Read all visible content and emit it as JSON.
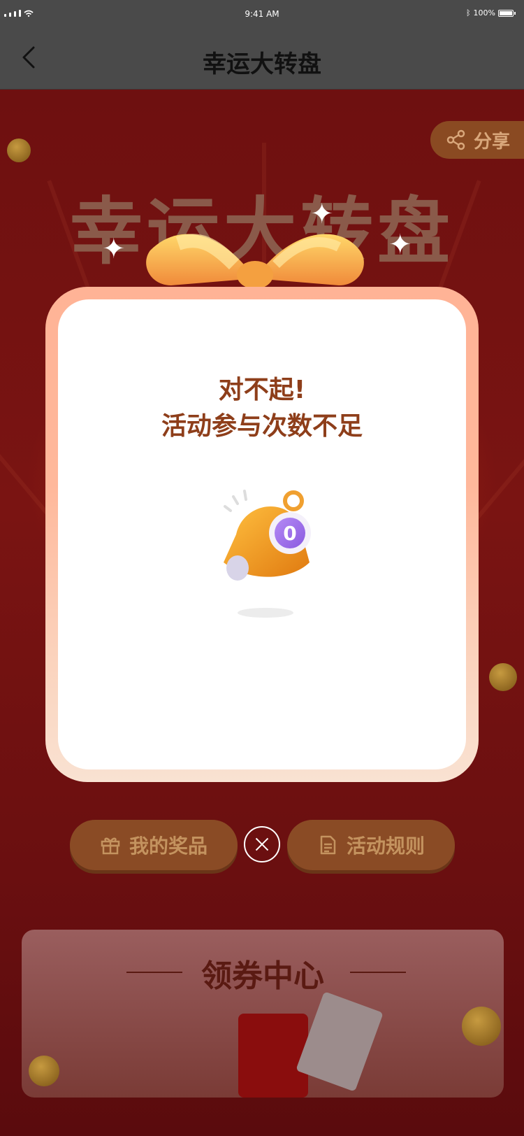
{
  "status_bar": {
    "time": "9:41 AM",
    "battery": "100%"
  },
  "nav": {
    "title": "幸运大转盘"
  },
  "page": {
    "big_title": "幸运大转盘",
    "share_label": "分享",
    "my_prizes_label": "我的奖品",
    "rules_label": "活动规则",
    "coupon_center_title": "领券中心"
  },
  "modal": {
    "line1": "对不起!",
    "line2": "活动参与次数不足",
    "bell_count": "0"
  },
  "icons": [
    "back-arrow-icon",
    "share-icon",
    "gift-icon",
    "document-icon",
    "close-icon",
    "bell-icon",
    "sparkle-icon"
  ]
}
